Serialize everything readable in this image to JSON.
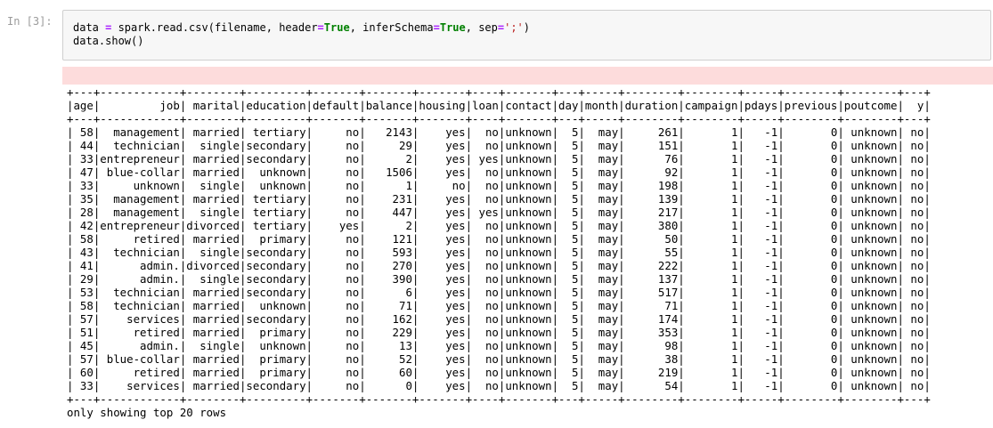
{
  "cell": {
    "prompt": "In [3]:",
    "code_line1": {
      "a": "data ",
      "eq1": "=",
      "b": " spark.read.csv(filename, header",
      "eq2": "=",
      "kw1": "True",
      "c": ", inferSchema",
      "eq3": "=",
      "kw2": "True",
      "d": ", sep",
      "eq4": "=",
      "s1": "';'",
      "e": ")"
    },
    "code_line2": "data.show()"
  },
  "output": {
    "table_text": "+---+------------+--------+---------+-------+-------+-------+----+-------+---+-----+--------+--------+-----+--------+--------+---+\n|age|         job| marital|education|default|balance|housing|loan|contact|day|month|duration|campaign|pdays|previous|poutcome|  y|\n+---+------------+--------+---------+-------+-------+-------+----+-------+---+-----+--------+--------+-----+--------+--------+---+\n| 58|  management| married| tertiary|     no|   2143|    yes|  no|unknown|  5|  may|     261|       1|   -1|       0| unknown| no|\n| 44|  technician|  single|secondary|     no|     29|    yes|  no|unknown|  5|  may|     151|       1|   -1|       0| unknown| no|\n| 33|entrepreneur| married|secondary|     no|      2|    yes| yes|unknown|  5|  may|      76|       1|   -1|       0| unknown| no|\n| 47| blue-collar| married|  unknown|     no|   1506|    yes|  no|unknown|  5|  may|      92|       1|   -1|       0| unknown| no|\n| 33|     unknown|  single|  unknown|     no|      1|     no|  no|unknown|  5|  may|     198|       1|   -1|       0| unknown| no|\n| 35|  management| married| tertiary|     no|    231|    yes|  no|unknown|  5|  may|     139|       1|   -1|       0| unknown| no|\n| 28|  management|  single| tertiary|     no|    447|    yes| yes|unknown|  5|  may|     217|       1|   -1|       0| unknown| no|\n| 42|entrepreneur|divorced| tertiary|    yes|      2|    yes|  no|unknown|  5|  may|     380|       1|   -1|       0| unknown| no|\n| 58|     retired| married|  primary|     no|    121|    yes|  no|unknown|  5|  may|      50|       1|   -1|       0| unknown| no|\n| 43|  technician|  single|secondary|     no|    593|    yes|  no|unknown|  5|  may|      55|       1|   -1|       0| unknown| no|\n| 41|      admin.|divorced|secondary|     no|    270|    yes|  no|unknown|  5|  may|     222|       1|   -1|       0| unknown| no|\n| 29|      admin.|  single|secondary|     no|    390|    yes|  no|unknown|  5|  may|     137|       1|   -1|       0| unknown| no|\n| 53|  technician| married|secondary|     no|      6|    yes|  no|unknown|  5|  may|     517|       1|   -1|       0| unknown| no|\n| 58|  technician| married|  unknown|     no|     71|    yes|  no|unknown|  5|  may|      71|       1|   -1|       0| unknown| no|\n| 57|    services| married|secondary|     no|    162|    yes|  no|unknown|  5|  may|     174|       1|   -1|       0| unknown| no|\n| 51|     retired| married|  primary|     no|    229|    yes|  no|unknown|  5|  may|     353|       1|   -1|       0| unknown| no|\n| 45|      admin.|  single|  unknown|     no|     13|    yes|  no|unknown|  5|  may|      98|       1|   -1|       0| unknown| no|\n| 57| blue-collar| married|  primary|     no|     52|    yes|  no|unknown|  5|  may|      38|       1|   -1|       0| unknown| no|\n| 60|     retired| married|  primary|     no|     60|    yes|  no|unknown|  5|  may|     219|       1|   -1|       0| unknown| no|\n| 33|    services| married|secondary|     no|      0|    yes|  no|unknown|  5|  may|      54|       1|   -1|       0| unknown| no|\n+---+------------+--------+---------+-------+-------+-------+----+-------+---+-----+--------+--------+-----+--------+--------+---+\nonly showing top 20 rows"
  },
  "colors": {
    "input_background": "#f7f7f7",
    "stderr_background": "#fddcdc",
    "keyword": "#008000",
    "operator": "#aa22ff",
    "string": "#ba2121",
    "prompt": "#9b9b9b"
  }
}
